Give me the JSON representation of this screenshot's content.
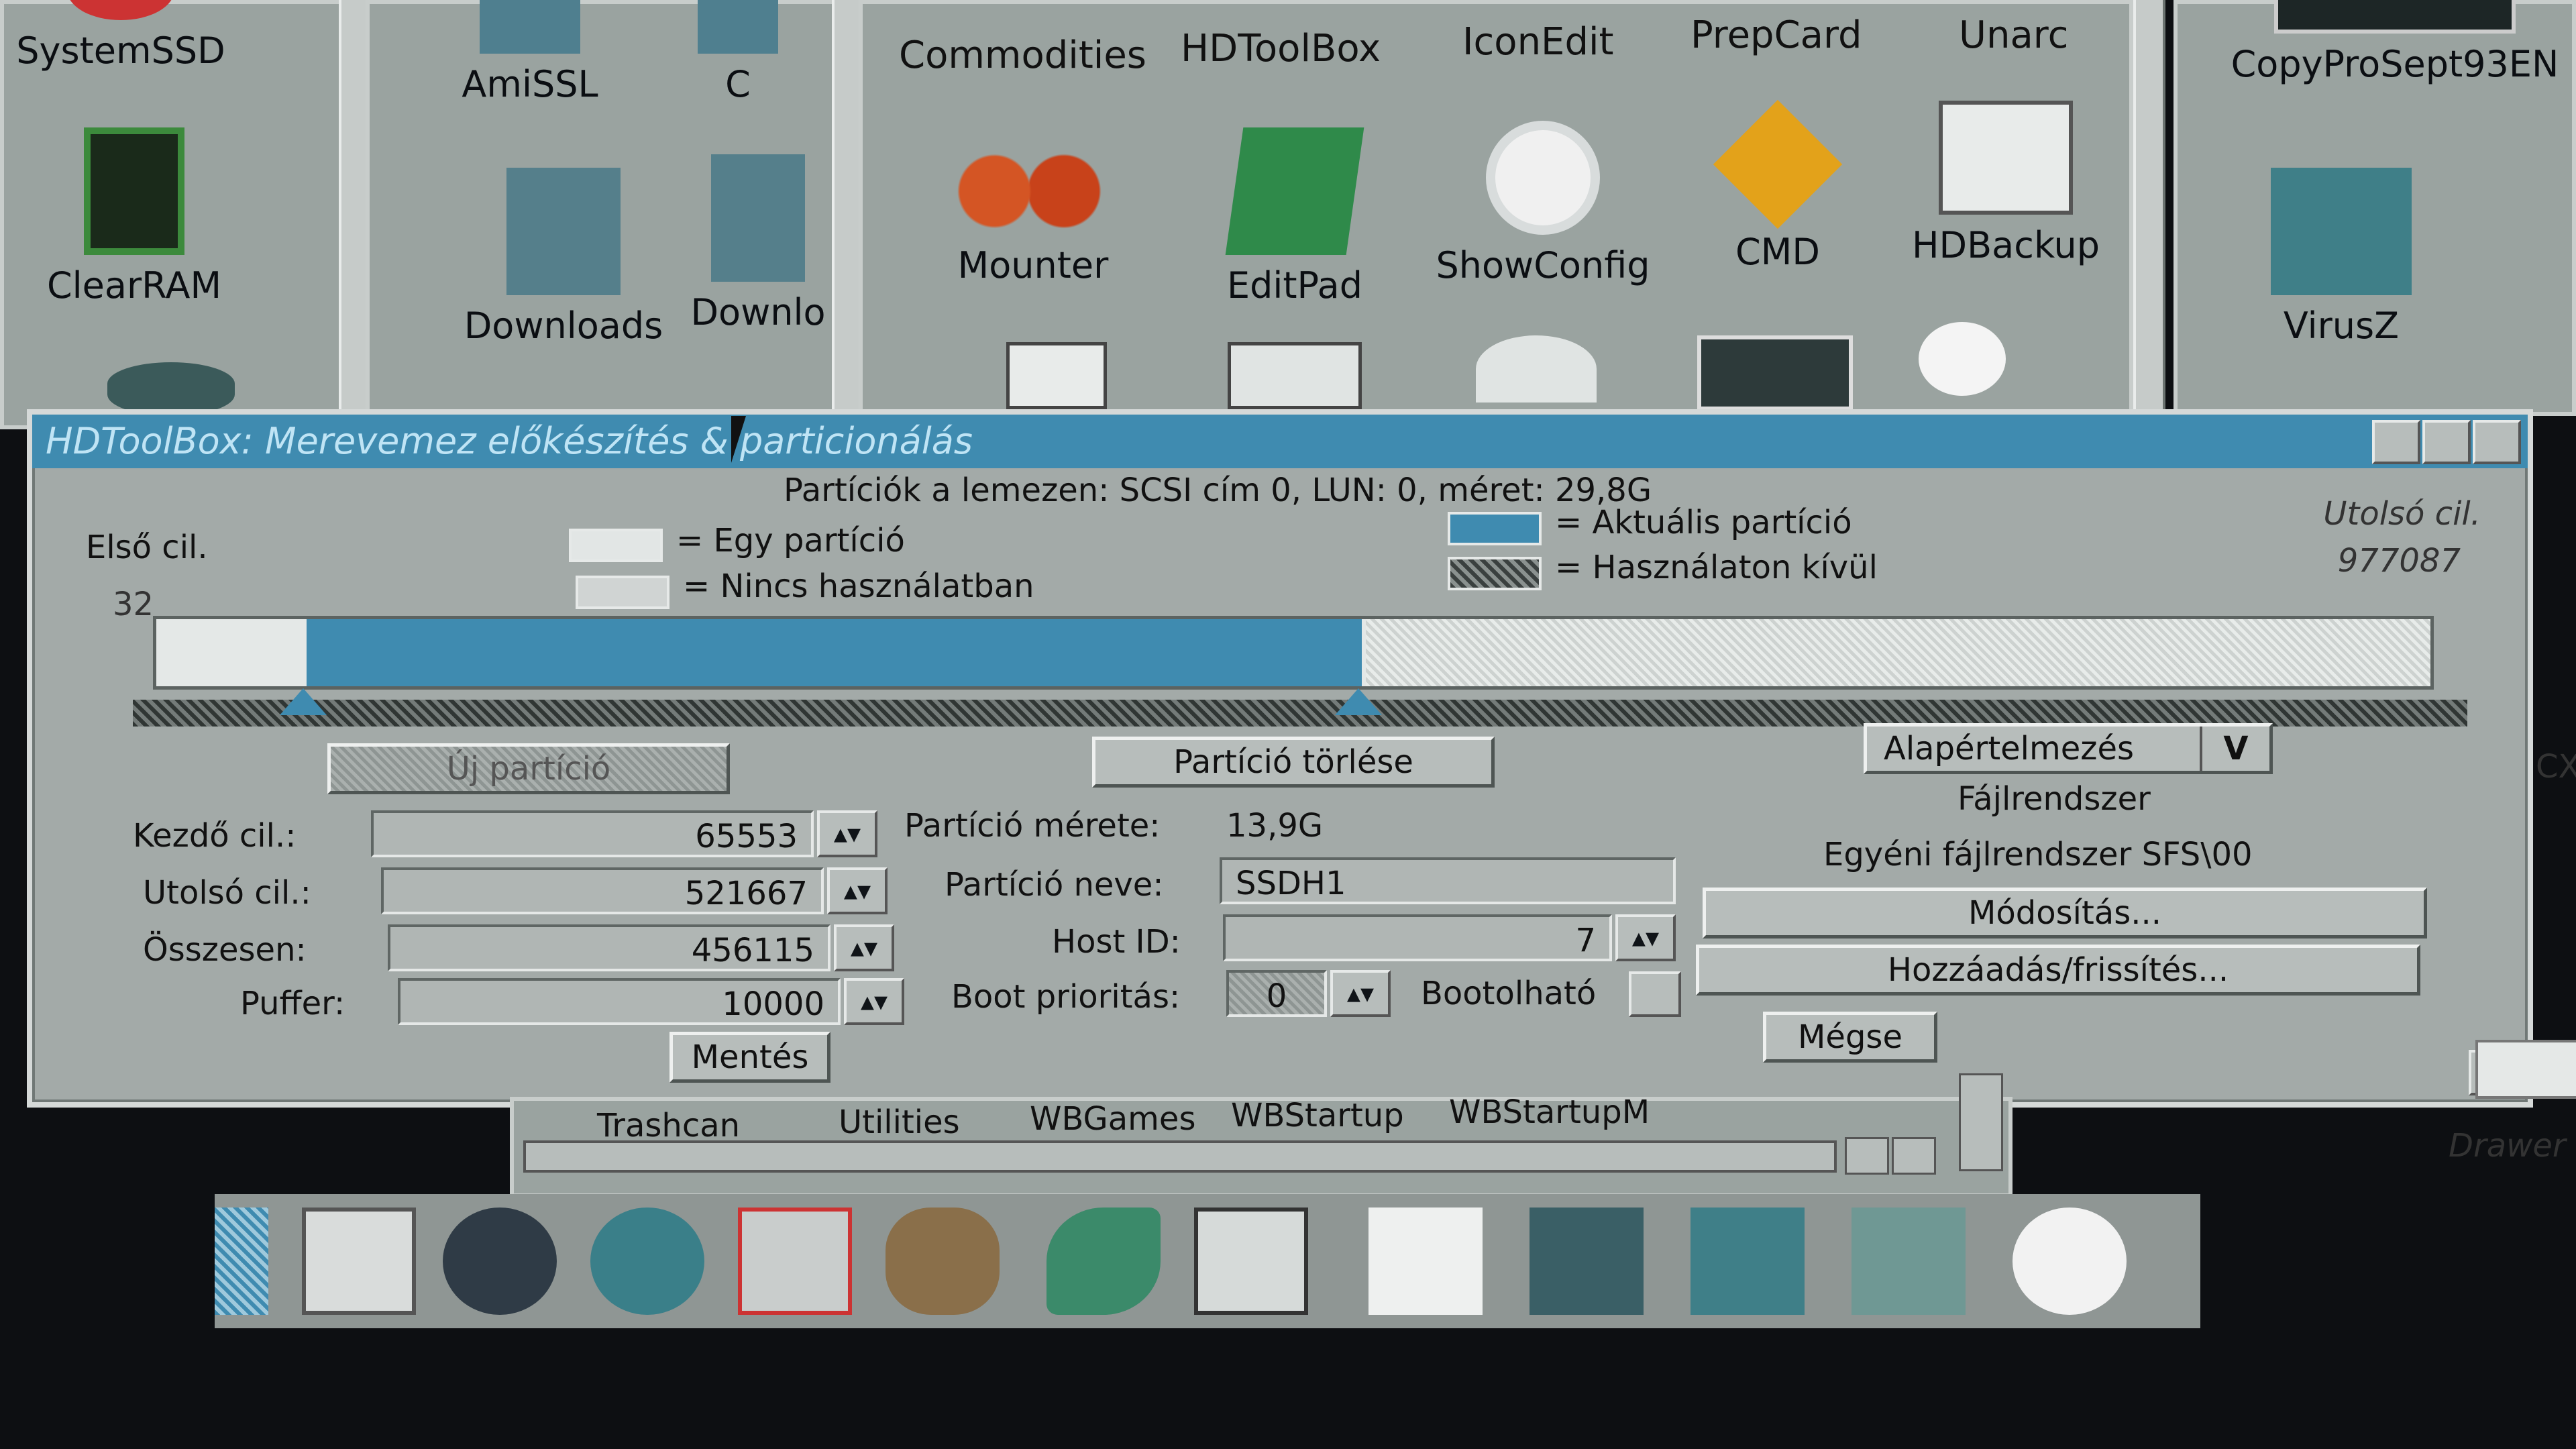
{
  "colors": {
    "accent": "#3f8bb0",
    "window_bg": "#a3aaa8",
    "desktop": "#9aa3a0"
  },
  "desktop": {
    "left_icons": [
      {
        "label": "SystemSSD",
        "icon": "drive-icon"
      },
      {
        "label": "ClearRAM",
        "icon": "chip-icon"
      }
    ],
    "window2_icons": [
      {
        "label": "AmiSSL",
        "icon": "drawer-icon"
      },
      {
        "label": "C",
        "icon": "drawer-icon"
      },
      {
        "label": "Downloads",
        "icon": "drawer-icon"
      },
      {
        "label": "Downlo",
        "icon": "drawer-icon"
      }
    ],
    "tools_row1": [
      "Commodities",
      "HDToolBox",
      "IconEdit",
      "PrepCard",
      "Unarc"
    ],
    "tools_row2": [
      {
        "label": "Mounter",
        "icon": "gears-icon"
      },
      {
        "label": "EditPad",
        "icon": "notepad-icon"
      },
      {
        "label": "ShowConfig",
        "icon": "magnifier-icon"
      },
      {
        "label": "CMD",
        "icon": "sign-icon"
      },
      {
        "label": "HDBackup",
        "icon": "backup-icon"
      }
    ],
    "right_icons": [
      {
        "label": "CopyProSept93EN",
        "icon": "disk-icon"
      },
      {
        "label": "VirusZ",
        "icon": "floppy-brush-icon"
      }
    ],
    "bottom_window_labels": [
      "Trashcan",
      "Utilities",
      "WBGames",
      "WBStartup",
      "WBStartupM"
    ],
    "right_edge_labels": [
      "Drawer",
      "CX"
    ]
  },
  "dialog": {
    "title": "HDToolBox: Merevemez előkészítés & particionálás",
    "header": "Partíciók a lemezen: SCSI cím 0, LUN: 0, méret: 29,8G",
    "first_cyl_label": "Első cil.",
    "first_cyl_value": "32",
    "last_cyl_label": "Utolsó cil.",
    "last_cyl_value": "977087",
    "legend": {
      "one_partition": "= Egy partíció",
      "unused": "= Nincs használatban",
      "current": "= Aktuális partíció",
      "out_of_use": "= Használaton kívül"
    },
    "partition_bar": {
      "start_fraction": 0.066,
      "current_end_fraction": 0.53
    },
    "new_partition_button": "Új partíció",
    "delete_partition_button": "Partíció törlése",
    "default_select": "Alapértelmezés",
    "start_cyl": {
      "label": "Kezdő cil.:",
      "value": "65553"
    },
    "end_cyl": {
      "label": "Utolsó cil.:",
      "value": "521667"
    },
    "total": {
      "label": "Összesen:",
      "value": "456115"
    },
    "buffer": {
      "label": "Puffer:",
      "value": "10000"
    },
    "size": {
      "label": "Partíció mérete:",
      "value": "13,9G"
    },
    "name": {
      "label": "Partíció neve:",
      "value": "SSDH1"
    },
    "host_id": {
      "label": "Host ID:",
      "value": "7"
    },
    "boot_priority": {
      "label": "Boot prioritás:",
      "value": "0"
    },
    "bootable_label": "Bootolható",
    "filesystem_label": "Fájlrendszer",
    "filesystem_value": "Egyéni fájlrendszer SFS\\00",
    "modify_button": "Módosítás...",
    "add_update_button": "Hozzáadás/frissítés...",
    "save_button": "Mentés",
    "cancel_button": "Mégse"
  }
}
